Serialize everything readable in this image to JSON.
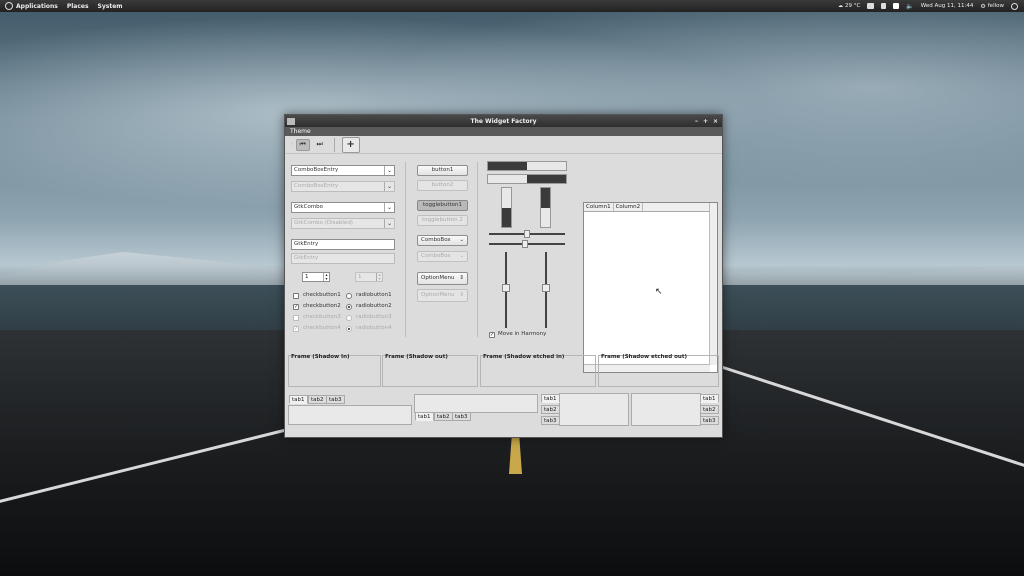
{
  "panel": {
    "menus": [
      "Applications",
      "Places",
      "System"
    ],
    "weather": "29 °C",
    "clock": "Wed Aug 11, 11:44",
    "user": "fellow"
  },
  "window": {
    "title": "The Widget Factory",
    "menu": [
      "Theme"
    ],
    "controls": [
      "–",
      "+",
      "×"
    ]
  },
  "col1": {
    "combo_entry": "ComboBoxEntry",
    "combo_entry_dis": "ComboBoxEntry",
    "gtk_combo": "GtkCombo",
    "gtk_combo_dis": "GtkCombo (Disabled)",
    "entry": "GtkEntry",
    "entry_dis": "GtkEntry",
    "spin": "1",
    "spin_dis": "1",
    "check1": "checkbutton1",
    "check2": "checkbutton2",
    "check3": "checkbutton3",
    "check4": "checkbutton4",
    "radio1": "radiobutton1",
    "radio2": "radiobutton2",
    "radio3": "radiobutton3",
    "radio4": "radiobutton4"
  },
  "col2": {
    "button1": "button1",
    "button2": "button2",
    "toggle1": "togglebutton1",
    "toggle2": "togglebutton 2",
    "combobox": "ComboBox",
    "combobox_dis": "ComboBox",
    "optionmenu": "OptionMenu",
    "optionmenu_dis": "OptionMenu"
  },
  "col3": {
    "move_in_harmony": "Move in Harmony"
  },
  "tree": {
    "columns": [
      "Column1",
      "Column2"
    ]
  },
  "frames": [
    "Frame (Shadow In)",
    "Frame (Shadow out)",
    "Frame (Shadow etched in)",
    "Frame (Shadow etched out)"
  ],
  "notebooks": {
    "tab1": "tab1",
    "tab2": "tab2",
    "tab3": "tab3"
  }
}
